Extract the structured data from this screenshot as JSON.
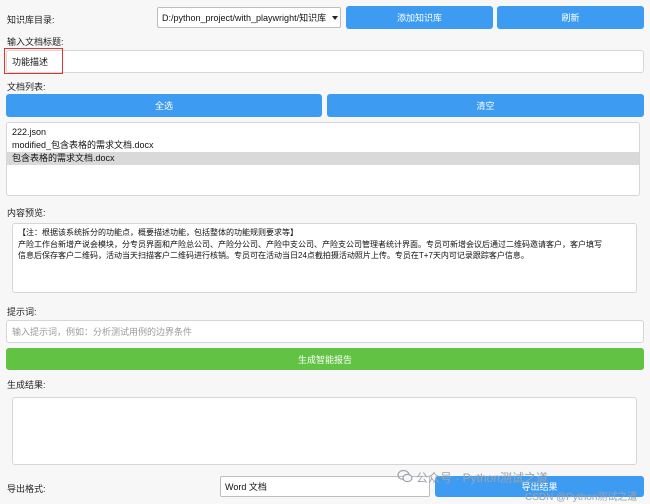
{
  "kb": {
    "dir_label": "知识库目录:",
    "dir_value": "D:/python_project/with_playwright/知识库",
    "add_button": "添加知识库",
    "refresh_button": "刷新"
  },
  "title_section": {
    "label": "输入文档标题:",
    "value": "功能描述"
  },
  "doc_list": {
    "label": "文档列表:",
    "select_all": "全选",
    "clear": "清空",
    "items": [
      "222.json",
      "modified_包含表格的需求文档.docx",
      "包含表格的需求文档.docx"
    ],
    "selected_index": 2
  },
  "preview": {
    "label": "内容预览:",
    "lines": [
      "【注：根据该系统拆分的功能点，概要描述功能，包括整体的功能规则要求等】",
      "产险工作台新增产说会模块，分专员界面和产险总公司、产险分公司、产险中支公司、产险支公司管理者统计界面。专员可新增会议后通过二维码邀请客户，客户填写",
      "信息后保存客户二维码，活动当天扫描客户二维码进行核销。专员可在活动当日24点截拍摄活动照片上传。专员在T+7天内可记录跟踪客户信息。"
    ]
  },
  "prompt": {
    "label": "提示词:",
    "placeholder": "输入提示词，例如：分析测试用例的边界条件",
    "generate_button": "生成智能报告"
  },
  "result": {
    "label": "生成结果:"
  },
  "export": {
    "label": "导出格式:",
    "format_value": "Word 文档",
    "export_button": "导出结果"
  },
  "overlay": {
    "watermark": "公众号 · Python测试之道",
    "csdn": "CSDN @Python测试之道"
  }
}
